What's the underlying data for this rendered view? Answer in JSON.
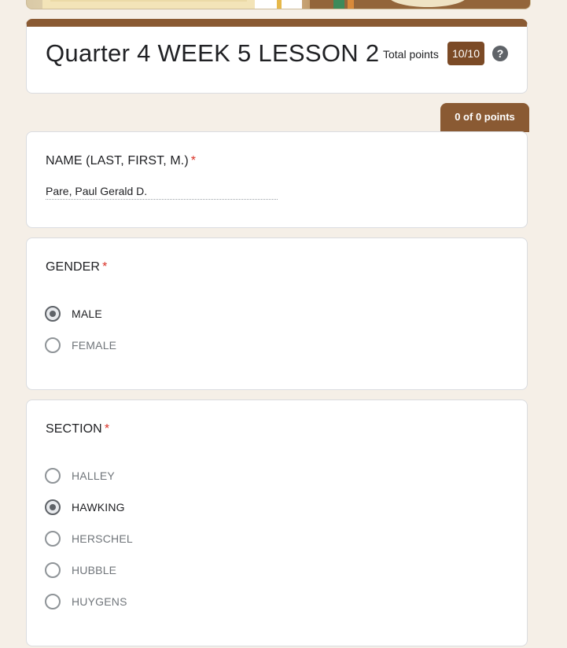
{
  "form": {
    "title": "Quarter 4 WEEK 5 LESSON 2",
    "total_points_label": "Total points",
    "total_points_value": "10/10",
    "help_icon": "help-circle-icon",
    "section_points": "0 of 0 points",
    "theme_color": "#8a5a33",
    "badge_color": "#7b4a26"
  },
  "questions": [
    {
      "title": "NAME (LAST, FIRST, M.)",
      "required_mark": "*",
      "answer": "Pare, Paul Gerald D."
    },
    {
      "title": "GENDER",
      "required_mark": "*",
      "options": [
        {
          "label": "MALE",
          "selected": true
        },
        {
          "label": "FEMALE",
          "selected": false
        }
      ]
    },
    {
      "title": "SECTION",
      "required_mark": "*",
      "options": [
        {
          "label": "HALLEY",
          "selected": false
        },
        {
          "label": "HAWKING",
          "selected": true
        },
        {
          "label": "HERSCHEL",
          "selected": false
        },
        {
          "label": "HUBBLE",
          "selected": false
        },
        {
          "label": "HUYGENS",
          "selected": false
        }
      ]
    }
  ]
}
